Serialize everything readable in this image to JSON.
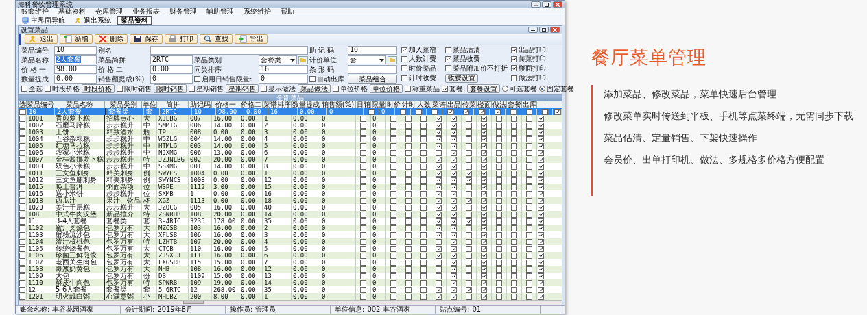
{
  "app": {
    "title": "海科餐饮管理系统",
    "menu": [
      "账套维护",
      "基础资料",
      "仓库管理",
      "业务报表",
      "财务管理",
      "辅助管理",
      "系统维护",
      "帮助"
    ],
    "tabs": [
      {
        "label": "主界面导航",
        "kind": "home",
        "selected": false
      },
      {
        "label": "退出系统",
        "kind": "exit",
        "selected": false
      },
      {
        "label": "菜品资料",
        "kind": "none",
        "selected": true
      }
    ],
    "subwindow_title": "设置菜品",
    "toolbar": [
      {
        "label": "退出",
        "kind": "exit"
      },
      {
        "label": "新增",
        "kind": "new"
      },
      {
        "label": "删除",
        "kind": "delete"
      },
      {
        "label": "保存",
        "kind": "save"
      },
      {
        "label": "打印",
        "kind": "print"
      },
      {
        "label": "查找",
        "kind": "find"
      },
      {
        "label": "导出",
        "kind": "export"
      }
    ],
    "form": {
      "code": {
        "label": "菜品编号",
        "value": "10"
      },
      "alias": {
        "label": "别名"
      },
      "mnemonic": {
        "label": "助 记 码",
        "value": "10"
      },
      "name": {
        "label": "菜品名称",
        "value": "2人套餐"
      },
      "pinyin": {
        "label": "菜品简拼",
        "value": "2RTC"
      },
      "category": {
        "label": "菜品类别",
        "value": "套餐类"
      },
      "unit": {
        "label": "计价单位",
        "value": "套"
      },
      "price1": {
        "label": "价 格 一",
        "value": "98.00"
      },
      "price2": {
        "label": "价 格 二",
        "value": "0.00"
      },
      "sort": {
        "label": "同类排序",
        "value": "16"
      },
      "barcode": {
        "label": "条 形 码"
      },
      "qty_commission": {
        "label": "数量提成",
        "value": "0.00"
      },
      "sales_commission": {
        "label": "销售额提成(%)",
        "value": "0"
      },
      "daily_limit": {
        "label": "启用日销售限量:",
        "checked": false,
        "value": "0"
      },
      "auto_out": {
        "label": "自动出库",
        "checked": false
      },
      "combo_button": "菜品组合"
    },
    "flags": [
      {
        "kind": "check",
        "label": "加入菜谱",
        "checked": true
      },
      {
        "kind": "check",
        "label": "菜品沽清",
        "checked": false
      },
      {
        "kind": "check",
        "label": "出品打印",
        "checked": true
      },
      {
        "kind": "check",
        "label": "人数计费",
        "checked": false
      },
      {
        "kind": "check",
        "label": "菜品收费",
        "checked": true
      },
      {
        "kind": "check",
        "label": "传菜打印",
        "checked": true
      },
      {
        "kind": "check",
        "label": "时价菜品",
        "checked": false
      },
      {
        "kind": "check",
        "label": "菜品附加价不打折",
        "checked": false
      },
      {
        "kind": "check",
        "label": "楼面打印",
        "checked": true
      },
      {
        "kind": "check",
        "label": "计时收费",
        "checked": false
      },
      {
        "kind": "button",
        "label": "收费设置"
      },
      {
        "kind": "check",
        "label": "做法打印",
        "checked": false
      }
    ],
    "options": [
      {
        "kind": "check",
        "label": "全选",
        "checked": false
      },
      {
        "kind": "check",
        "label": "时段价格",
        "checked": false
      },
      {
        "kind": "button",
        "label": "时段价格"
      },
      {
        "kind": "check",
        "label": "限时销售",
        "checked": false
      },
      {
        "kind": "button",
        "label": "限时销售"
      },
      {
        "kind": "check",
        "label": "星期销售",
        "checked": false
      },
      {
        "kind": "button",
        "label": "星期销售"
      },
      {
        "kind": "check",
        "label": "显示做法",
        "checked": false
      },
      {
        "kind": "button",
        "label": "菜品做法"
      },
      {
        "kind": "check",
        "label": "单位价格",
        "checked": false
      },
      {
        "kind": "button",
        "label": "单位价格"
      },
      {
        "kind": "check",
        "label": "称重菜品",
        "checked": false
      },
      {
        "kind": "check",
        "label": "套餐:",
        "checked": true
      },
      {
        "kind": "button",
        "label": "套餐设置"
      }
    ],
    "combo_mode": [
      {
        "label": "可选套餐",
        "selected": false
      },
      {
        "label": "固定套餐",
        "selected": true
      }
    ],
    "table": {
      "title": "全部菜品",
      "columns": [
        {
          "label": "选",
          "kind": "check"
        },
        {
          "label": "菜品编号",
          "kind": "text"
        },
        {
          "label": "菜品名称",
          "kind": "text"
        },
        {
          "label": "菜品类别",
          "kind": "text"
        },
        {
          "label": "单位",
          "kind": "text"
        },
        {
          "label": "简拼",
          "kind": "text"
        },
        {
          "label": "助记码",
          "kind": "text"
        },
        {
          "label": "价格一",
          "kind": "text"
        },
        {
          "label": "价格二",
          "kind": "text"
        },
        {
          "label": "菜谱排序",
          "kind": "text"
        },
        {
          "label": "数量提成",
          "kind": "text"
        },
        {
          "label": "销售额(%)",
          "kind": "text"
        },
        {
          "label": "日销",
          "kind": "check"
        },
        {
          "label": "限量",
          "kind": "text"
        },
        {
          "label": "时价",
          "kind": "check"
        },
        {
          "label": "计时",
          "kind": "check"
        },
        {
          "label": "人数",
          "kind": "check"
        },
        {
          "label": "菜谱",
          "kind": "check"
        },
        {
          "label": "出品",
          "kind": "check"
        },
        {
          "label": "传菜",
          "kind": "check"
        },
        {
          "label": "楼面",
          "kind": "check"
        },
        {
          "label": "做法",
          "kind": "check"
        },
        {
          "label": "套餐",
          "kind": "check"
        },
        {
          "label": "出库",
          "kind": "check"
        },
        {
          "kind": "check"
        }
      ],
      "rows": [
        {
          "selected": true,
          "cells": [
            false,
            "10",
            "2人套餐",
            "套餐类",
            "套",
            "2RTC",
            "10",
            "98.00",
            "0.00",
            "16",
            "0.00",
            "0",
            false,
            "0",
            false,
            false,
            false,
            true,
            true,
            true,
            true,
            false,
            false,
            false,
            true
          ]
        },
        {
          "selected": false,
          "cells": [
            false,
            "1001",
            "香煎萝卜糕",
            "招牌点心",
            "大",
            "XJLBG",
            "007",
            "16.00",
            "0.00",
            "1",
            "0.00",
            "0",
            false,
            "0",
            false,
            false,
            false,
            true,
            true,
            false,
            true,
            false,
            false,
            false,
            true
          ]
        },
        {
          "selected": false,
          "cells": [
            false,
            "1002",
            "石磨马蹄糕",
            "步步糕升",
            "中",
            "SMMTG",
            "006",
            "14.00",
            "0.00",
            "2",
            "0.00",
            "0",
            false,
            "0",
            false,
            false,
            false,
            true,
            true,
            false,
            true,
            false,
            false,
            false,
            true
          ]
        },
        {
          "selected": false,
          "cells": [
            false,
            "1003",
            "土饼",
            "精致酒水",
            "瓶",
            "TP",
            "008",
            "0.00",
            "0.00",
            "3",
            "0.00",
            "0",
            false,
            "0",
            false,
            false,
            false,
            true,
            true,
            false,
            true,
            false,
            false,
            false,
            true
          ]
        },
        {
          "selected": false,
          "cells": [
            false,
            "1004",
            "五谷杂粮糕",
            "步步糕升",
            "中",
            "WGZLG",
            "004",
            "14.00",
            "0.00",
            "4",
            "0.00",
            "0",
            false,
            "0",
            false,
            false,
            false,
            true,
            true,
            false,
            true,
            false,
            false,
            false,
            true
          ]
        },
        {
          "selected": false,
          "cells": [
            false,
            "1005",
            "红糖马拉糕",
            "步步糕升",
            "中",
            "HTMLG",
            "003",
            "14.00",
            "0.00",
            "5",
            "0.00",
            "0",
            false,
            "0",
            false,
            false,
            false,
            true,
            true,
            false,
            true,
            false,
            false,
            false,
            true
          ]
        },
        {
          "selected": false,
          "cells": [
            false,
            "1006",
            "农家小米糕",
            "步步糕升",
            "中",
            "NJXMG",
            "006",
            "13.00",
            "0.00",
            "6",
            "0.00",
            "0",
            false,
            "0",
            false,
            false,
            false,
            false,
            true,
            false,
            true,
            false,
            false,
            false,
            true
          ]
        },
        {
          "selected": false,
          "cells": [
            false,
            "1007",
            "金桂酱娜萝卜糕",
            "步步糕升",
            "特",
            "JZJNLBG",
            "002",
            "20.00",
            "0.00",
            "7",
            "0.00",
            "0",
            false,
            "0",
            false,
            false,
            false,
            true,
            true,
            false,
            true,
            false,
            false,
            false,
            true
          ]
        },
        {
          "selected": false,
          "cells": [
            false,
            "1008",
            "双色小米糕",
            "步步糕升",
            "中",
            "SSXMG",
            "001",
            "14.00",
            "0.00",
            "8",
            "0.00",
            "0",
            false,
            "0",
            false,
            false,
            false,
            true,
            true,
            false,
            true,
            false,
            false,
            false,
            true
          ]
        },
        {
          "selected": false,
          "cells": [
            false,
            "1011",
            "三文鱼刺身",
            "精美刺身",
            "例",
            "SWYCS",
            "1004",
            "0.00",
            "0.00",
            "11",
            "0.00",
            "0",
            false,
            "0",
            false,
            false,
            false,
            true,
            true,
            true,
            true,
            false,
            false,
            false,
            true
          ]
        },
        {
          "selected": false,
          "cells": [
            false,
            "1012",
            "三文鱼腩刺身",
            "精美刺身",
            "例",
            "SWYNCS",
            "1008",
            "0.00",
            "0.00",
            "12",
            "0.00",
            "0",
            false,
            "0",
            false,
            false,
            false,
            true,
            true,
            true,
            true,
            false,
            false,
            false,
            true
          ]
        },
        {
          "selected": false,
          "cells": [
            false,
            "1015",
            "晚上普洱",
            "粥面杂项",
            "位",
            "WSPE",
            "1112",
            "3.00",
            "0.00",
            "15",
            "0.00",
            "0",
            false,
            "0",
            false,
            false,
            false,
            true,
            true,
            false,
            true,
            false,
            false,
            false,
            true
          ]
        },
        {
          "selected": false,
          "cells": [
            false,
            "1016",
            "送小米饼",
            "步步糕升",
            "位",
            "SXMB",
            "1",
            "0.00",
            "0.00",
            "16",
            "0.00",
            "0",
            false,
            "0",
            false,
            false,
            false,
            true,
            true,
            false,
            true,
            false,
            false,
            false,
            true
          ]
        },
        {
          "selected": false,
          "cells": [
            false,
            "1018",
            "西瓜汁",
            "果汁、饮品",
            "杯",
            "XGZ",
            "1113",
            "0.00",
            "0.00",
            "18",
            "0.00",
            "0",
            false,
            "0",
            false,
            false,
            false,
            true,
            true,
            true,
            true,
            false,
            false,
            false,
            true
          ]
        },
        {
          "selected": false,
          "cells": [
            false,
            "1020",
            "姜汁千层糕",
            "步步糕升",
            "大",
            "JZQCG",
            "005",
            "16.00",
            "0.00",
            "40",
            "0.00",
            "0",
            false,
            "0",
            false,
            false,
            false,
            true,
            true,
            false,
            true,
            false,
            false,
            false,
            true
          ]
        },
        {
          "selected": false,
          "cells": [
            false,
            "108",
            "中式牛肉汉堡",
            "新品推介",
            "特",
            "ZSNRHB",
            "108",
            "20.00",
            "0.00",
            "14",
            "0.00",
            "0",
            false,
            "0",
            false,
            false,
            false,
            true,
            true,
            false,
            true,
            false,
            false,
            false,
            true
          ]
        },
        {
          "selected": false,
          "cells": [
            false,
            "11",
            "3-4人套餐",
            "套餐类",
            "套",
            "3-4RTC",
            "3235",
            "178.00",
            "0.00",
            "35",
            "0.00",
            "0",
            false,
            "0",
            false,
            false,
            false,
            true,
            true,
            true,
            true,
            false,
            false,
            false,
            true
          ]
        },
        {
          "selected": false,
          "cells": [
            false,
            "1102",
            "蜜汁叉烧包",
            "包罗万有",
            "大",
            "MZCSB",
            "103",
            "16.00",
            "0.00",
            "2",
            "0.00",
            "0",
            false,
            "0",
            false,
            false,
            false,
            true,
            true,
            false,
            true,
            false,
            false,
            false,
            true
          ]
        },
        {
          "selected": false,
          "cells": [
            false,
            "1103",
            "蟹粉流沙包",
            "包罗万有",
            "大",
            "XFLSB",
            "106",
            "16.00",
            "0.00",
            "3",
            "0.00",
            "0",
            false,
            "0",
            false,
            false,
            false,
            true,
            true,
            false,
            true,
            false,
            false,
            false,
            true
          ]
        },
        {
          "selected": false,
          "cells": [
            false,
            "1104",
            "流汁核桃包",
            "包罗万有",
            "特",
            "LZHTB",
            "107",
            "20.00",
            "0.00",
            "4",
            "0.00",
            "0",
            false,
            "0",
            false,
            false,
            false,
            false,
            true,
            false,
            true,
            false,
            false,
            false,
            true
          ]
        },
        {
          "selected": false,
          "cells": [
            false,
            "1105",
            "传统烧餐包",
            "包罗万有",
            "大",
            "CTCB",
            "110",
            "16.00",
            "0.00",
            "5",
            "0.00",
            "0",
            false,
            "0",
            false,
            false,
            false,
            true,
            true,
            false,
            true,
            false,
            false,
            false,
            true
          ]
        },
        {
          "selected": false,
          "cells": [
            false,
            "1106",
            "珍菌三鲜煎饺",
            "包罗万有",
            "大",
            "ZJSXJJ",
            "111",
            "16.00",
            "0.00",
            "6",
            "0.00",
            "0",
            false,
            "0",
            false,
            false,
            false,
            true,
            true,
            false,
            true,
            false,
            false,
            false,
            true
          ]
        },
        {
          "selected": false,
          "cells": [
            false,
            "1107",
            "老西关生肉包",
            "包罗万有",
            "大",
            "LXGSRB",
            "115",
            "15.00",
            "0.00",
            "7",
            "0.00",
            "0",
            false,
            "0",
            false,
            false,
            false,
            false,
            true,
            false,
            true,
            false,
            false,
            false,
            true
          ]
        },
        {
          "selected": false,
          "cells": [
            false,
            "1108",
            "爆浆奶黄包",
            "包罗万有",
            "大",
            "NHB",
            "108",
            "16.00",
            "0.00",
            "12",
            "0.00",
            "0",
            false,
            "0",
            false,
            false,
            false,
            false,
            true,
            false,
            true,
            false,
            false,
            false,
            true
          ]
        },
        {
          "selected": false,
          "cells": [
            false,
            "1109",
            "大包",
            "包罗万有",
            "份",
            "DB",
            "1109",
            "15.00",
            "0.00",
            "13",
            "0.00",
            "0",
            false,
            "0",
            false,
            false,
            false,
            false,
            true,
            false,
            true,
            false,
            false,
            false,
            true
          ]
        },
        {
          "selected": false,
          "cells": [
            false,
            "1110",
            "酥皮牛肉包",
            "包罗万有",
            "特",
            "SPNRB",
            "109",
            "19.00",
            "0.00",
            "14",
            "0.00",
            "0",
            false,
            "0",
            false,
            false,
            false,
            false,
            true,
            false,
            true,
            false,
            false,
            false,
            true
          ]
        },
        {
          "selected": false,
          "cells": [
            false,
            "12",
            "5-6人套餐",
            "套餐类",
            "套",
            "5-6RTC",
            "12",
            "268.00",
            "0.00",
            "35",
            "0.00",
            "0",
            false,
            "0",
            false,
            false,
            false,
            true,
            true,
            true,
            true,
            false,
            false,
            false,
            true
          ]
        },
        {
          "selected": false,
          "cells": [
            false,
            "1201",
            "明火靓白粥",
            "心满意粥",
            "小",
            "MHLBZ",
            "200",
            "8.00",
            "0.00",
            "1",
            "0.00",
            "0",
            false,
            "0",
            false,
            false,
            false,
            true,
            true,
            false,
            true,
            false,
            false,
            false,
            true
          ]
        }
      ]
    },
    "status_bar": [
      {
        "label": "账套名称:",
        "value": "丰谷花园酒家"
      },
      {
        "label": "会计期间:",
        "value": "2019年8月"
      },
      {
        "label": "操作员:",
        "value": "管理员"
      },
      {
        "label": "单位信息:",
        "value": "002 丰谷酒家"
      },
      {
        "label": "站点编号:",
        "value": "01"
      }
    ]
  },
  "panel": {
    "title": "餐厅菜单管理",
    "lines": [
      "添加菜品、修改菜品，菜单快速后台管理",
      "修改菜单实时传送到平板、手机等点菜终端，无需同步下载",
      "菜品估清、定量销售、下架快速操作",
      "会员价、出单打印机、做法、多规格多价格方便配置"
    ]
  }
}
